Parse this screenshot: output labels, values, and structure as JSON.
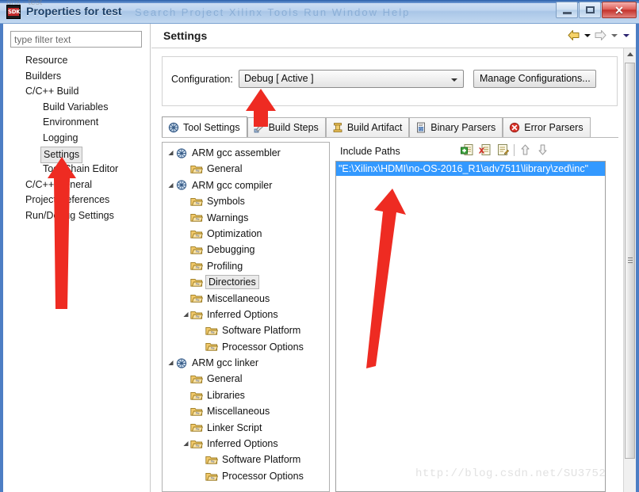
{
  "window": {
    "title": "Properties for test",
    "icon": "sdk-icon",
    "icon_text": "SDK",
    "ghost_menu": "Search  Project  Xilinx Tools  Run  Window  Help",
    "ghost_top": "gnx - test",
    "buttons": {
      "minimize": "minimize-button",
      "restore": "restore-button",
      "close": "close-button",
      "close_glyph": "✕"
    }
  },
  "sidebar": {
    "filter_placeholder": "type filter text",
    "filter_value": "",
    "items": [
      {
        "label": "Resource",
        "indent": 0,
        "twisty": "collapsed",
        "selected": false
      },
      {
        "label": "Builders",
        "indent": 0,
        "twisty": "none",
        "selected": false
      },
      {
        "label": "C/C++ Build",
        "indent": 0,
        "twisty": "expanded",
        "selected": false
      },
      {
        "label": "Build Variables",
        "indent": 1,
        "twisty": "none",
        "selected": false
      },
      {
        "label": "Environment",
        "indent": 1,
        "twisty": "none",
        "selected": false
      },
      {
        "label": "Logging",
        "indent": 1,
        "twisty": "none",
        "selected": false
      },
      {
        "label": "Settings",
        "indent": 1,
        "twisty": "none",
        "selected": true
      },
      {
        "label": "Tool Chain Editor",
        "indent": 1,
        "twisty": "none",
        "selected": false
      },
      {
        "label": "C/C++ General",
        "indent": 0,
        "twisty": "collapsed",
        "selected": false
      },
      {
        "label": "Project References",
        "indent": 0,
        "twisty": "none",
        "selected": false
      },
      {
        "label": "Run/Debug Settings",
        "indent": 0,
        "twisty": "none",
        "selected": false
      }
    ]
  },
  "page": {
    "title": "Settings",
    "nav": {
      "back": "back-arrow-icon",
      "back_menu": "back-dropdown-icon",
      "forward": "forward-arrow-icon",
      "forward_menu": "forward-dropdown-icon",
      "view_menu": "view-menu-icon"
    }
  },
  "configuration": {
    "label": "Configuration:",
    "selected": "Debug  [ Active ]",
    "options": [
      "Debug  [ Active ]"
    ],
    "manage_button": "Manage Configurations..."
  },
  "tabs": [
    {
      "label": "Tool Settings",
      "icon": "tool-settings-icon",
      "active": true
    },
    {
      "label": "Build Steps",
      "icon": "build-steps-icon",
      "active": false
    },
    {
      "label": "Build Artifact",
      "icon": "build-artifact-icon",
      "active": false
    },
    {
      "label": "Binary Parsers",
      "icon": "binary-parsers-icon",
      "active": false
    },
    {
      "label": "Error Parsers",
      "icon": "error-parsers-icon",
      "active": false
    }
  ],
  "tool_tree": [
    {
      "label": "ARM gcc assembler",
      "indent": 0,
      "twisty": "expanded",
      "icon": "tool-icon",
      "selected": false
    },
    {
      "label": "General",
      "indent": 1,
      "twisty": "none",
      "icon": "folder-icon",
      "selected": false
    },
    {
      "label": "ARM gcc compiler",
      "indent": 0,
      "twisty": "expanded",
      "icon": "tool-icon",
      "selected": false
    },
    {
      "label": "Symbols",
      "indent": 1,
      "twisty": "none",
      "icon": "folder-icon",
      "selected": false
    },
    {
      "label": "Warnings",
      "indent": 1,
      "twisty": "none",
      "icon": "folder-icon",
      "selected": false
    },
    {
      "label": "Optimization",
      "indent": 1,
      "twisty": "none",
      "icon": "folder-icon",
      "selected": false
    },
    {
      "label": "Debugging",
      "indent": 1,
      "twisty": "none",
      "icon": "folder-icon",
      "selected": false
    },
    {
      "label": "Profiling",
      "indent": 1,
      "twisty": "none",
      "icon": "folder-icon",
      "selected": false
    },
    {
      "label": "Directories",
      "indent": 1,
      "twisty": "none",
      "icon": "folder-icon",
      "selected": true
    },
    {
      "label": "Miscellaneous",
      "indent": 1,
      "twisty": "none",
      "icon": "folder-icon",
      "selected": false
    },
    {
      "label": "Inferred Options",
      "indent": 1,
      "twisty": "expanded",
      "icon": "folder-icon",
      "selected": false
    },
    {
      "label": "Software Platform",
      "indent": 2,
      "twisty": "none",
      "icon": "folder-icon",
      "selected": false
    },
    {
      "label": "Processor Options",
      "indent": 2,
      "twisty": "none",
      "icon": "folder-icon",
      "selected": false
    },
    {
      "label": "ARM gcc linker",
      "indent": 0,
      "twisty": "expanded",
      "icon": "tool-icon",
      "selected": false
    },
    {
      "label": "General",
      "indent": 1,
      "twisty": "none",
      "icon": "folder-icon",
      "selected": false
    },
    {
      "label": "Libraries",
      "indent": 1,
      "twisty": "none",
      "icon": "folder-icon",
      "selected": false
    },
    {
      "label": "Miscellaneous",
      "indent": 1,
      "twisty": "none",
      "icon": "folder-icon",
      "selected": false
    },
    {
      "label": "Linker Script",
      "indent": 1,
      "twisty": "none",
      "icon": "folder-icon",
      "selected": false
    },
    {
      "label": "Inferred Options",
      "indent": 1,
      "twisty": "expanded",
      "icon": "folder-icon",
      "selected": false
    },
    {
      "label": "Software Platform",
      "indent": 2,
      "twisty": "none",
      "icon": "folder-icon",
      "selected": false
    },
    {
      "label": "Processor Options",
      "indent": 2,
      "twisty": "none",
      "icon": "folder-icon",
      "selected": false
    }
  ],
  "include_paths": {
    "title": "Include Paths",
    "toolbar": [
      {
        "name": "add-include-path-button",
        "enabled": true
      },
      {
        "name": "delete-include-path-button",
        "enabled": true
      },
      {
        "name": "edit-include-path-button",
        "enabled": true
      },
      {
        "name": "move-up-button",
        "enabled": false
      },
      {
        "name": "move-down-button",
        "enabled": false
      }
    ],
    "entries": [
      {
        "value": "\"E:\\Xilinx\\HDMI\\no-OS-2016_R1\\adv7511\\library\\zed\\inc\"",
        "selected": true
      }
    ]
  },
  "watermark": "http://blog.csdn.net/SU3752",
  "annotations": {
    "color": "#ee2b22",
    "arrows": [
      {
        "name": "arrow-to-settings-sidebar"
      },
      {
        "name": "arrow-to-configuration-combo"
      },
      {
        "name": "arrow-to-include-path-entry"
      }
    ]
  },
  "colors": {
    "selection_blue": "#3399ff",
    "title_blue": "#4d7ec4",
    "annotation_red": "#ee2b22"
  }
}
